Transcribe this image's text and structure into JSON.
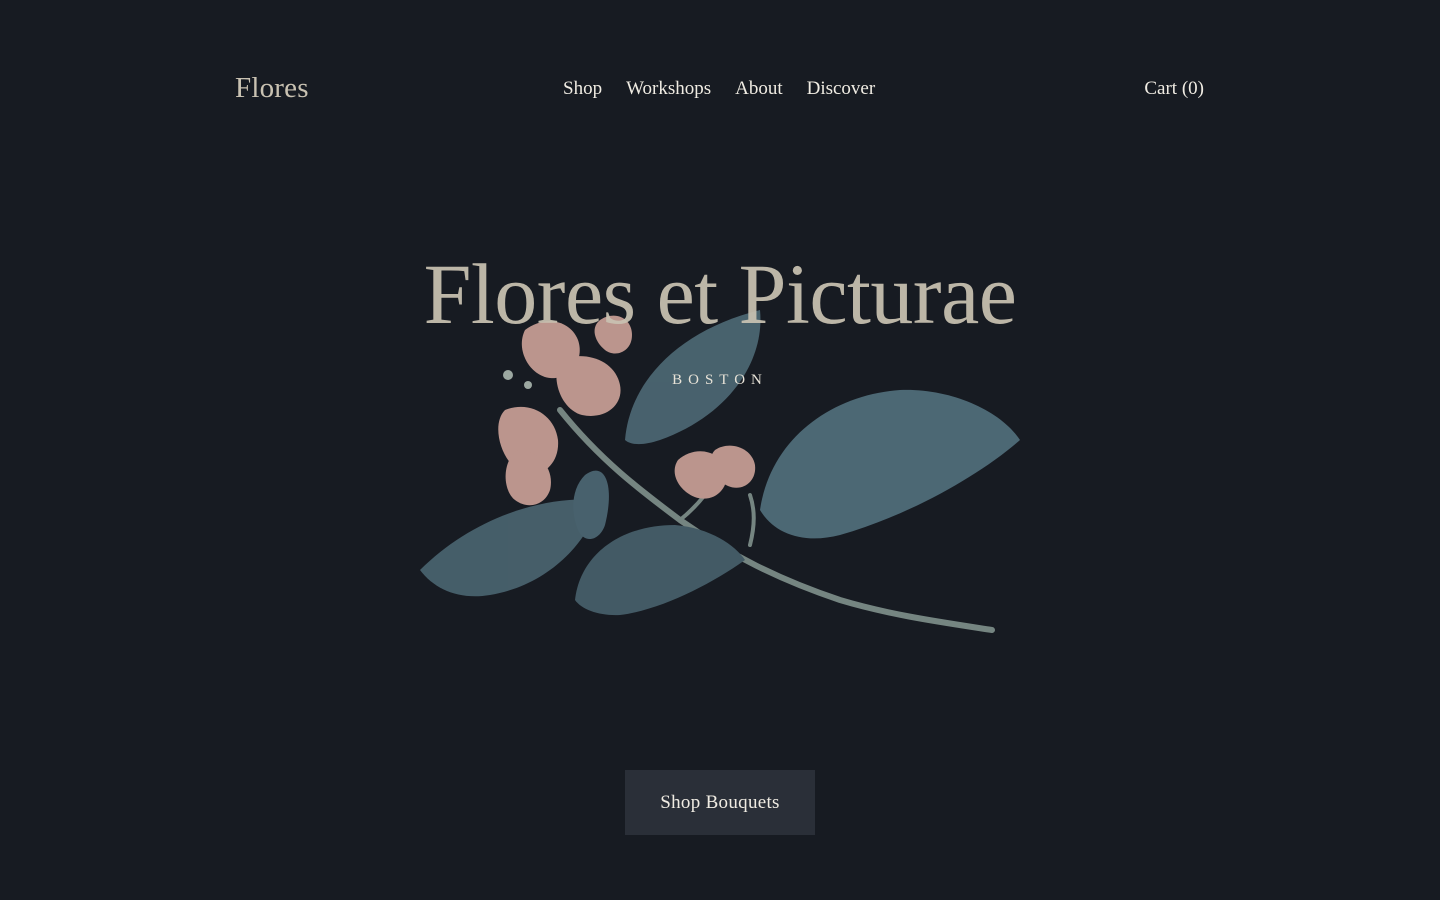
{
  "header": {
    "brand": "Flores",
    "nav": [
      {
        "label": "Shop"
      },
      {
        "label": "Workshops"
      },
      {
        "label": "About"
      },
      {
        "label": "Discover"
      }
    ],
    "cart_label": "Cart (0)"
  },
  "hero": {
    "title": "Flores et Picturae",
    "subtitle": "BOSTON",
    "image_icon": "flowering-branch-illustration",
    "cta_label": "Shop Bouquets"
  },
  "colors": {
    "background": "#171b22",
    "title": "#c9c2b2",
    "text": "#f0ece3",
    "button_bg": "#2a2f38",
    "leaf": "#4d6874",
    "petal": "#c9a097",
    "stem": "#7e8e8a"
  }
}
